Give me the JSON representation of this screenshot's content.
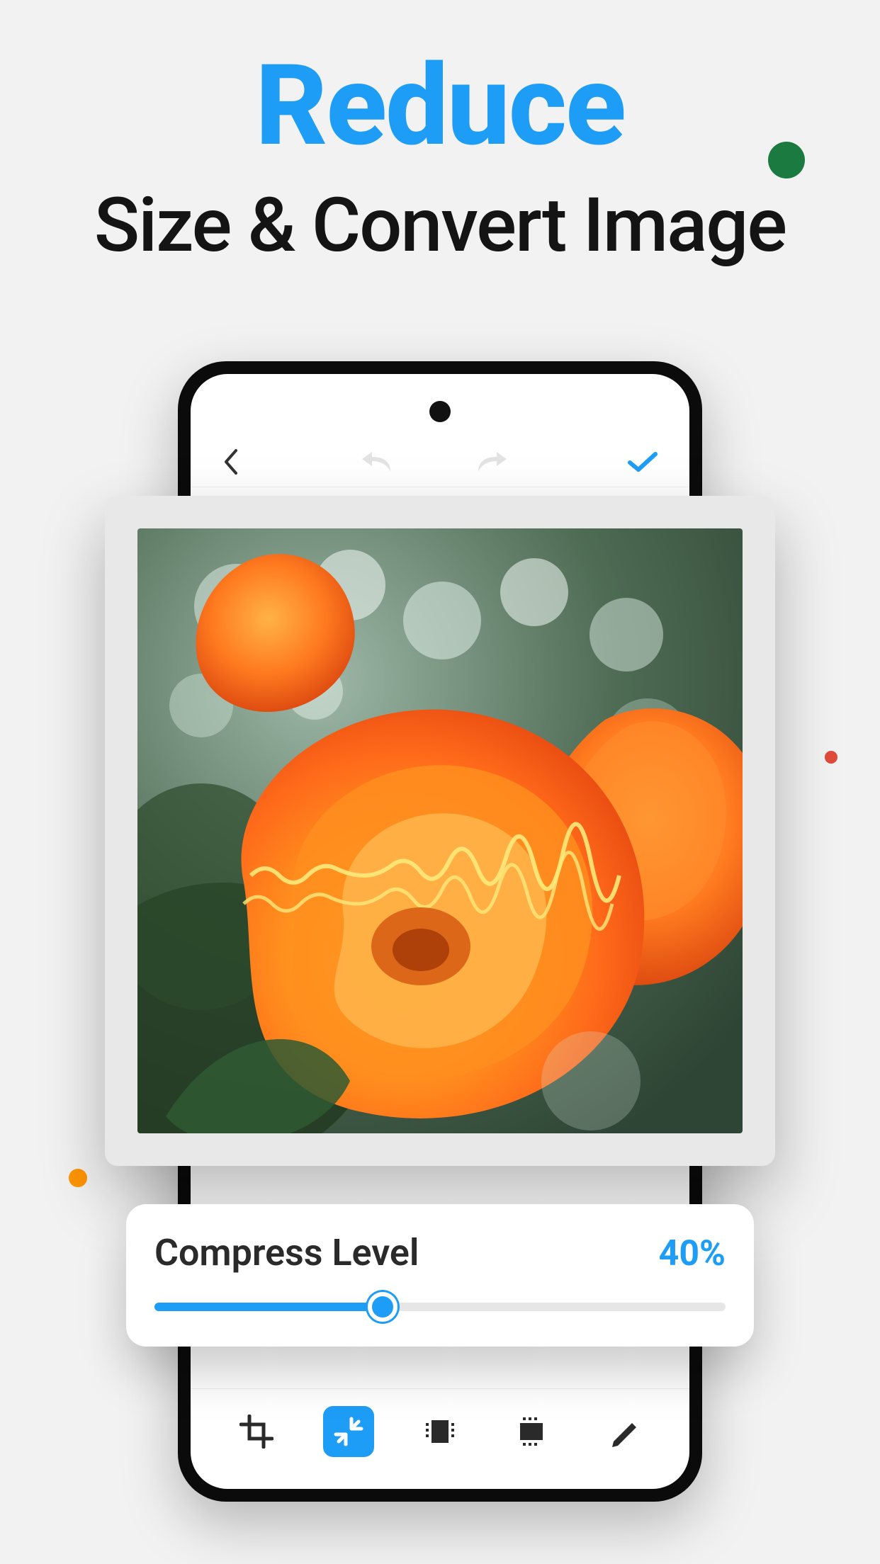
{
  "headline": {
    "top": "Reduce",
    "sub": "Size & Convert Image"
  },
  "slider": {
    "title": "Compress Level",
    "value_label": "40%",
    "percent": 40
  },
  "colors": {
    "accent": "#1e9df7",
    "green_dot": "#1a7a3f",
    "red_dot": "#e04a3a",
    "orange_dot": "#ff9500"
  },
  "toolbar": {
    "items": [
      "crop",
      "compress",
      "resize-width",
      "resize-height",
      "edit"
    ],
    "active_index": 1
  }
}
